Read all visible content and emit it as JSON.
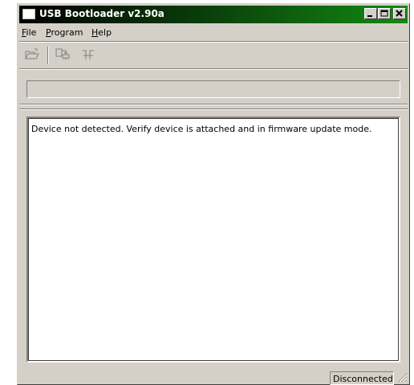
{
  "window": {
    "title": "USB Bootloader v2.90a"
  },
  "menu": [
    {
      "underline": "F",
      "rest": "ile"
    },
    {
      "underline": "P",
      "rest": "rogram"
    },
    {
      "underline": "H",
      "rest": "elp"
    }
  ],
  "toolbar": {
    "icons": [
      "open-folder-icon",
      "program-device-icon",
      "reset-device-icon"
    ]
  },
  "log": {
    "message": "Device not detected.  Verify device is attached and in firmware update mode."
  },
  "statusbar": {
    "connection": "Disconnected"
  },
  "colors": {
    "titlebar_start": "#000000",
    "titlebar_end": "#128a12",
    "face": "#d4d0c8"
  }
}
